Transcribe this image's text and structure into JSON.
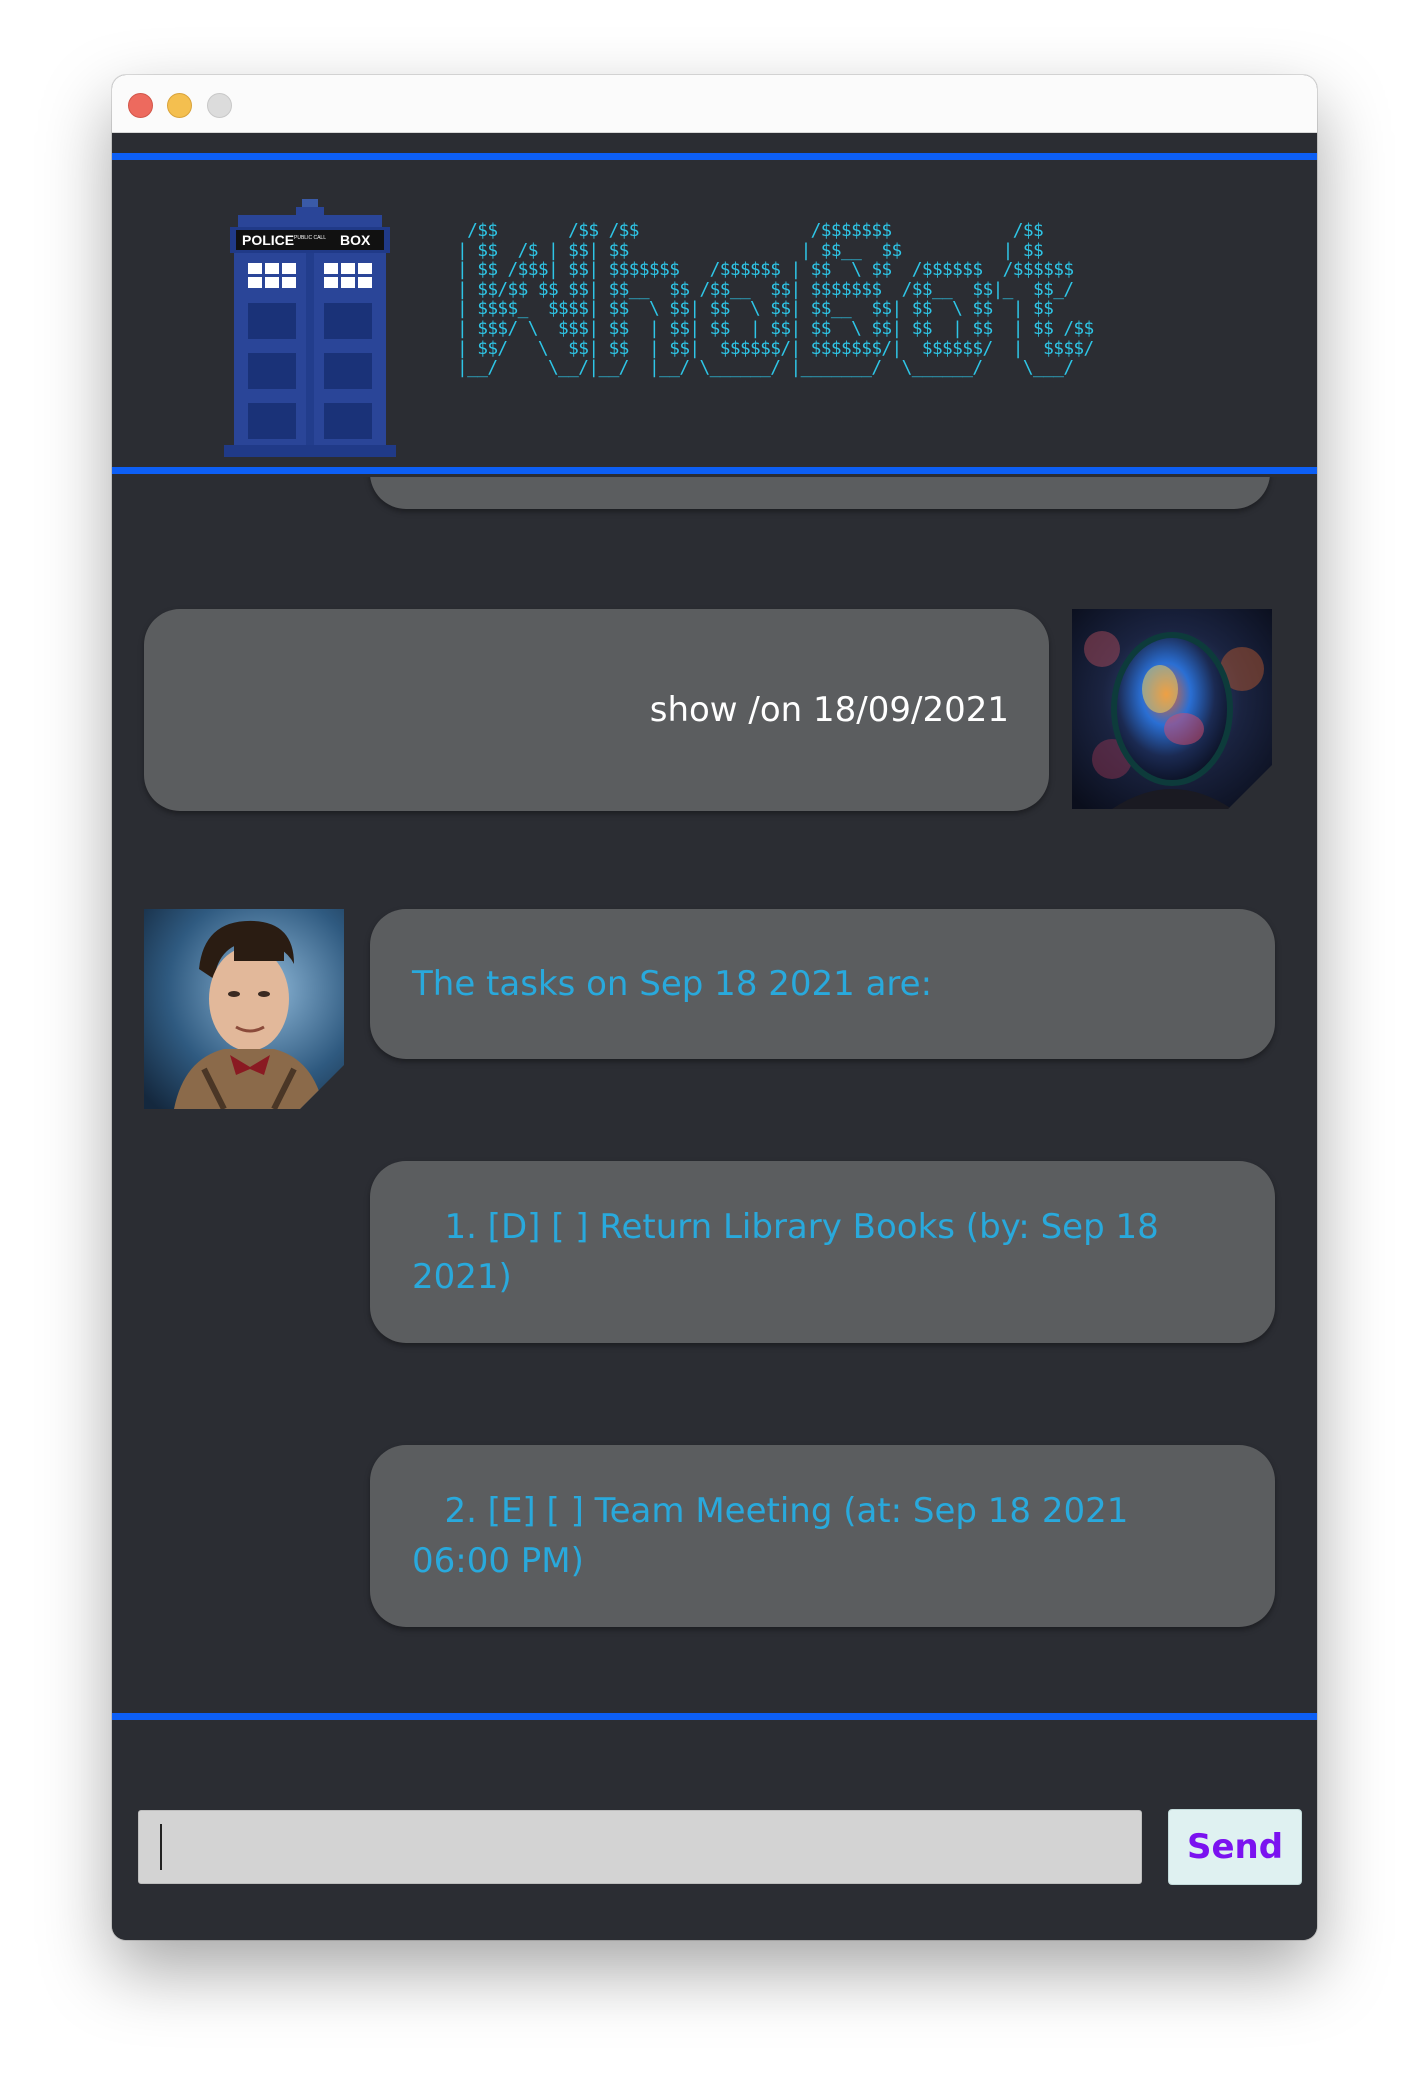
{
  "window": {
    "traffic_lights": [
      "close",
      "minimize",
      "zoom"
    ]
  },
  "header": {
    "logo_icon": "police-box-tardis",
    "tardis_sign": {
      "left": "POLICE",
      "middle": "PUBLIC CALL",
      "right": "BOX"
    },
    "ascii_banner": " /$$       /$$ /$$                 /$$$$$$$            /$$\n| $$  /$ | $$| $$                 | $$__  $$          | $$\n| $$ /$$$| $$| $$$$$$$   /$$$$$$ | $$  \\ $$  /$$$$$$  /$$$$$$\n| $$/$$ $$ $$| $$__  $$ /$$__  $$| $$$$$$$  /$$__  $$|_  $$_/\n| $$$$_  $$$$| $$  \\ $$| $$  \\ $$| $$__  $$| $$  \\ $$  | $$\n| $$$/ \\  $$$| $$  | $$| $$  | $$| $$  \\ $$| $$  | $$  | $$ /$$\n| $$/   \\  $$| $$  | $$|  $$$$$$/| $$$$$$$/|  $$$$$$/  |  $$$$/\n|__/     \\__/|__/  |__/ \\______/ |_______/  \\______/    \\___/"
  },
  "chat": {
    "messages": [
      {
        "role": "user",
        "text": "show /on 18/09/2021",
        "avatar": "space-helmet-avatar"
      },
      {
        "role": "bot",
        "text": "The tasks on Sep 18 2021 are:",
        "avatar": "doctor-avatar"
      },
      {
        "role": "bot",
        "text": "   1. [D] [ ] Return Library Books (by: Sep 18 2021)"
      },
      {
        "role": "bot",
        "text": "   2. [E] [ ] Team Meeting (at: Sep 18 2021 06:00 PM)"
      }
    ]
  },
  "input": {
    "value": "",
    "placeholder": "",
    "send_label": "Send"
  },
  "colors": {
    "background": "#2b2d33",
    "rule": "#0d5ff5",
    "bubble": "#5b5d5f",
    "bot_text": "#29a9dc",
    "user_text": "#ffffff",
    "ascii": "#2ec5e6",
    "send_text": "#7b12f0",
    "send_bg": "#dff1f1"
  }
}
